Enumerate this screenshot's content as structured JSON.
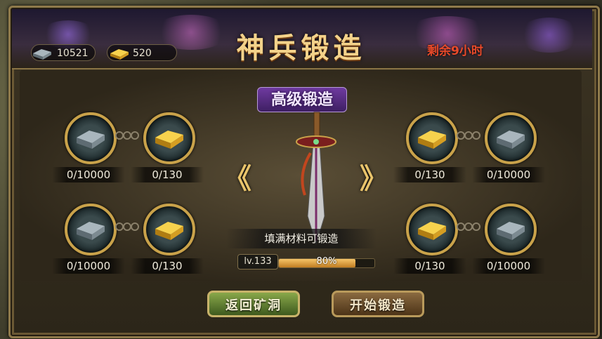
{
  "header": {
    "title": "神兵锻造",
    "time_left": "剩余9小时"
  },
  "resources": {
    "iron": "10521",
    "gold": "520"
  },
  "forge": {
    "mode": "高级锻造",
    "hint": "填满材料可锻造",
    "level": "lv.133",
    "progress_label": "80%",
    "progress": 0.8,
    "prev_arrow": "《",
    "next_arrow": "》"
  },
  "materials": {
    "left_top": [
      {
        "type": "iron",
        "count": "0/10000"
      },
      {
        "type": "gold",
        "count": "0/130"
      }
    ],
    "left_bottom": [
      {
        "type": "iron",
        "count": "0/10000"
      },
      {
        "type": "gold",
        "count": "0/130"
      }
    ],
    "right_top": [
      {
        "type": "gold",
        "count": "0/130"
      },
      {
        "type": "iron",
        "count": "0/10000"
      }
    ],
    "right_bottom": [
      {
        "type": "gold",
        "count": "0/130"
      },
      {
        "type": "iron",
        "count": "0/10000"
      }
    ]
  },
  "buttons": {
    "back": "返回矿洞",
    "start": "开始锻造"
  },
  "colors": {
    "accent_gold": "#f3d28a",
    "timer_red": "#e84a2a",
    "mode_purple": "#6f3aa0",
    "back_green": "#6f8e3a"
  },
  "icons": {
    "iron": "iron-ingot-icon",
    "gold": "gold-ingot-icon",
    "weapon": "sword-icon"
  }
}
